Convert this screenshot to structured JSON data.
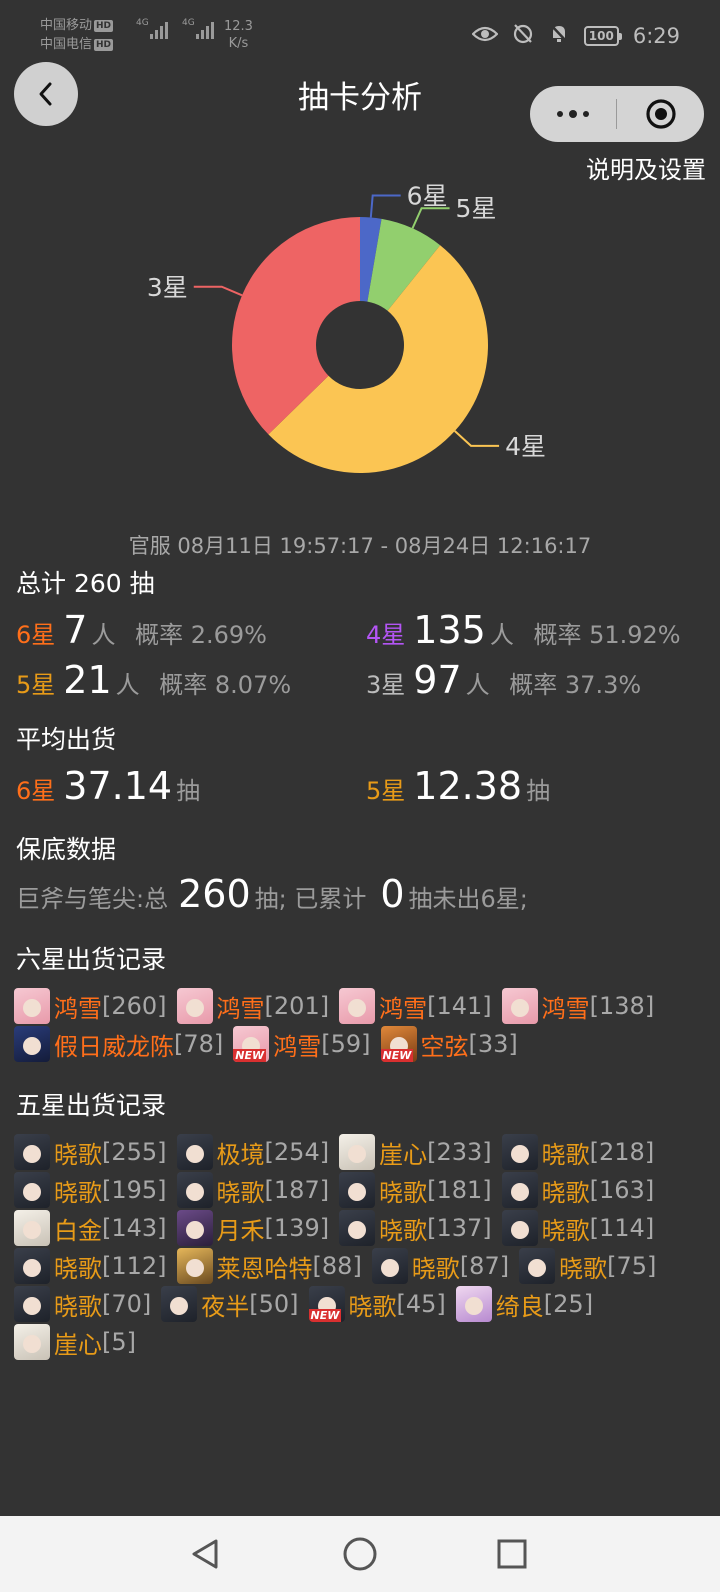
{
  "status_bar": {
    "carrier1": "中国移动",
    "carrier2": "中国电信",
    "hd": "HD",
    "net1": "4G",
    "net2": "4G",
    "speed_value": "12.3",
    "speed_unit": "K/s",
    "battery": "100",
    "time": "6:29"
  },
  "header": {
    "title": "抽卡分析",
    "settings_label": "说明及设置"
  },
  "chart_data": {
    "type": "pie",
    "style": "donut",
    "slices": [
      {
        "label": "6星",
        "value": 7,
        "color": "#4c68c8"
      },
      {
        "label": "5星",
        "value": 21,
        "color": "#92cf6e"
      },
      {
        "label": "4星",
        "value": 135,
        "color": "#fbc553"
      },
      {
        "label": "3星",
        "value": 97,
        "color": "#ee6464"
      }
    ]
  },
  "summary": {
    "range": "官服  08月11日 19:57:17  -  08月24日 12:16:17",
    "total": "总计 260 抽",
    "rows": [
      {
        "star": "6星",
        "count": "7",
        "unit": "人",
        "rate": "概率 2.69%"
      },
      {
        "star": "4星",
        "count": "135",
        "unit": "人",
        "rate": "概率 51.92%"
      },
      {
        "star": "5星",
        "count": "21",
        "unit": "人",
        "rate": "概率 8.07%"
      },
      {
        "star": "3星",
        "count": "97",
        "unit": "人",
        "rate": "概率 37.3%"
      }
    ]
  },
  "average": {
    "heading": "平均出货",
    "six_star": "6星",
    "six_value": "37.14",
    "five_star": "5星",
    "five_value": "12.38",
    "unit": "抽"
  },
  "pity": {
    "heading": "保底数据",
    "prefix": "巨斧与笔尖:总",
    "total": "260",
    "mid": "抽; 已累计",
    "count": "0",
    "suffix": "抽未出6星;"
  },
  "six_star_records": {
    "heading": "六星出货记录",
    "new_badge": "NEW",
    "row1": [
      {
        "name": "鸿雪",
        "count": "[260]"
      },
      {
        "name": "鸿雪",
        "count": "[201]"
      },
      {
        "name": "鸿雪",
        "count": "[141]"
      },
      {
        "name": "鸿雪",
        "count": "[138]"
      }
    ],
    "row2": [
      {
        "name": "假日威龙陈",
        "count": "[78]"
      },
      {
        "name": "鸿雪",
        "count": "[59]"
      },
      {
        "name": "空弦",
        "count": "[33]"
      }
    ]
  },
  "five_star_records": {
    "heading": "五星出货记录",
    "rows": [
      [
        {
          "name": "晓歌",
          "count": "[255]"
        },
        {
          "name": "极境",
          "count": "[254]"
        },
        {
          "name": "崖心",
          "count": "[233]"
        },
        {
          "name": "晓歌",
          "count": "[218]"
        }
      ],
      [
        {
          "name": "晓歌",
          "count": "[195]"
        },
        {
          "name": "晓歌",
          "count": "[187]"
        },
        {
          "name": "晓歌",
          "count": "[181]"
        },
        {
          "name": "晓歌",
          "count": "[163]"
        }
      ],
      [
        {
          "name": "白金",
          "count": "[143]"
        },
        {
          "name": "月禾",
          "count": "[139]"
        },
        {
          "name": "晓歌",
          "count": "[137]"
        },
        {
          "name": "晓歌",
          "count": "[114]"
        }
      ],
      [
        {
          "name": "晓歌",
          "count": "[112]"
        },
        {
          "name": "莱恩哈特",
          "count": "[88]"
        },
        {
          "name": "晓歌",
          "count": "[87]"
        },
        {
          "name": "晓歌",
          "count": "[75]"
        }
      ],
      [
        {
          "name": "晓歌",
          "count": "[70]"
        },
        {
          "name": "夜半",
          "count": "[50]"
        },
        {
          "name": "晓歌",
          "count": "[45]"
        },
        {
          "name": "绮良",
          "count": "[25]"
        }
      ],
      [
        {
          "name": "崖心",
          "count": "[5]"
        }
      ]
    ]
  }
}
